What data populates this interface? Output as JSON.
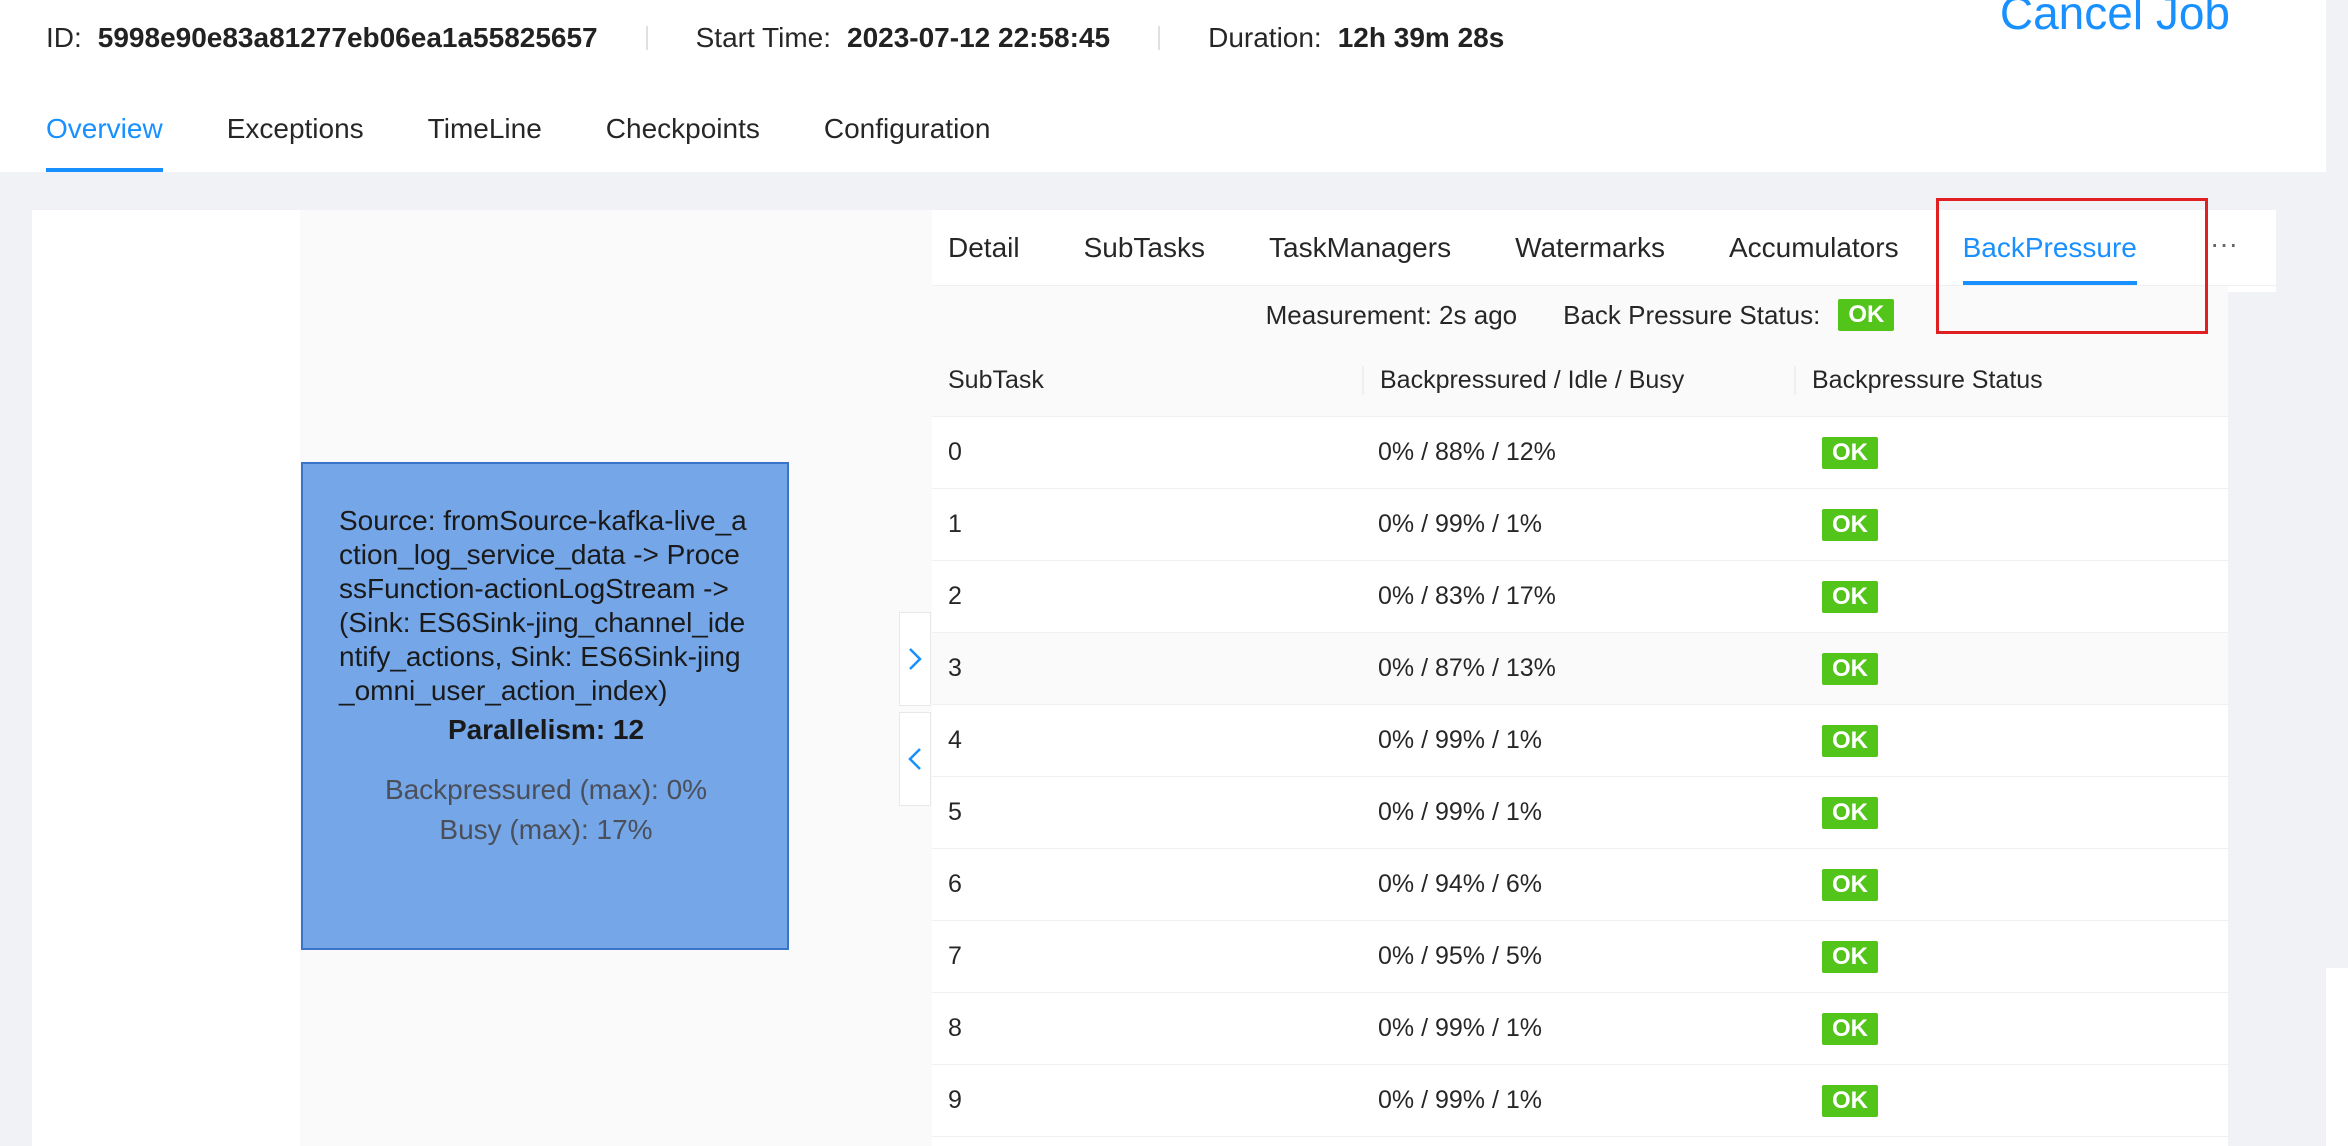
{
  "header": {
    "id_label": "ID:",
    "id_value": "5998e90e83a81277eb06ea1a55825657",
    "start_label": "Start Time:",
    "start_value": "2023-07-12 22:58:45",
    "duration_label": "Duration:",
    "duration_value": "12h 39m 28s",
    "cancel_label": "Cancel Job"
  },
  "job_tabs": [
    {
      "label": "Overview",
      "active": true
    },
    {
      "label": "Exceptions",
      "active": false
    },
    {
      "label": "TimeLine",
      "active": false
    },
    {
      "label": "Checkpoints",
      "active": false
    },
    {
      "label": "Configuration",
      "active": false
    }
  ],
  "vertex": {
    "name": "Source: fromSource-kafka-live_action_log_service_data -> ProcessFunction-actionLogStream -> (Sink: ES6Sink-jing_channel_identify_actions, Sink: ES6Sink-jing_omni_user_action_index)",
    "parallelism": "Parallelism: 12",
    "backpressured": "Backpressured (max): 0%",
    "busy": "Busy (max): 17%"
  },
  "detail_tabs": [
    {
      "label": "Detail",
      "active": false
    },
    {
      "label": "SubTasks",
      "active": false
    },
    {
      "label": "TaskManagers",
      "active": false
    },
    {
      "label": "Watermarks",
      "active": false
    },
    {
      "label": "Accumulators",
      "active": false
    },
    {
      "label": "BackPressure",
      "active": true
    }
  ],
  "more_label": "···",
  "backpressure": {
    "measurement": "Measurement: 2s ago",
    "status_label": "Back Pressure Status:",
    "status_value": "OK",
    "columns": [
      "SubTask",
      "Backpressured / Idle / Busy",
      "Backpressure Status"
    ],
    "rows": [
      {
        "subtask": "0",
        "ratio": "0% / 88% / 12%",
        "status": "OK"
      },
      {
        "subtask": "1",
        "ratio": "0% / 99% / 1%",
        "status": "OK"
      },
      {
        "subtask": "2",
        "ratio": "0% / 83% / 17%",
        "status": "OK"
      },
      {
        "subtask": "3",
        "ratio": "0% / 87% / 13%",
        "status": "OK"
      },
      {
        "subtask": "4",
        "ratio": "0% / 99% / 1%",
        "status": "OK"
      },
      {
        "subtask": "5",
        "ratio": "0% / 99% / 1%",
        "status": "OK"
      },
      {
        "subtask": "6",
        "ratio": "0% / 94% / 6%",
        "status": "OK"
      },
      {
        "subtask": "7",
        "ratio": "0% / 95% / 5%",
        "status": "OK"
      },
      {
        "subtask": "8",
        "ratio": "0% / 99% / 1%",
        "status": "OK"
      },
      {
        "subtask": "9",
        "ratio": "0% / 99% / 1%",
        "status": "OK"
      }
    ]
  },
  "colors": {
    "accent": "#1890ff",
    "ok": "#52c41a",
    "vertex_fill": "#74a6e8",
    "highlight": "#e02020"
  }
}
